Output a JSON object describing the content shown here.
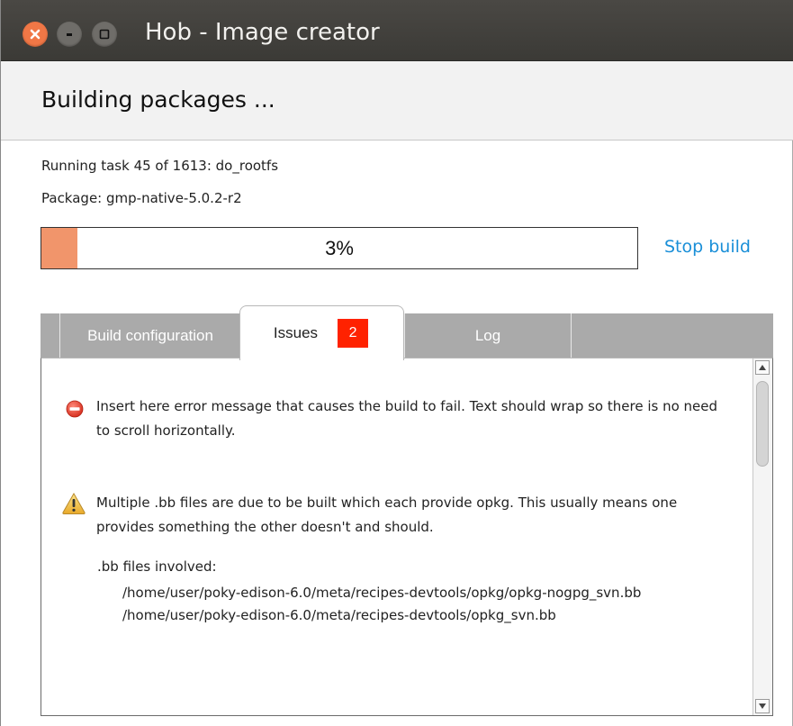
{
  "window": {
    "title": "Hob - Image creator",
    "close_glyph": "✕",
    "minimize_glyph": "-",
    "maximize_glyph": "□"
  },
  "header": {
    "title": "Building packages ..."
  },
  "status": {
    "task_line": "Running task 45 of 1613:  do_rootfs",
    "package_line": "Package: gmp-native-5.0.2-r2"
  },
  "progress": {
    "percent": 3,
    "label": "3%",
    "fill_color": "#f1956b"
  },
  "actions": {
    "stop_build_label": "Stop build",
    "link_color": "#1a8fd8"
  },
  "tabs": [
    {
      "label": "Build configuration",
      "active": false
    },
    {
      "label": "Issues",
      "active": true,
      "badge": "2",
      "badge_color": "#ff2200"
    },
    {
      "label": "Log",
      "active": false
    }
  ],
  "issues": {
    "error": {
      "icon": "error-icon",
      "text": "Insert here error message that causes the build to fail. Text should wrap so there is no need to scroll horizontally."
    },
    "warning": {
      "icon": "warning-icon",
      "text": "Multiple .bb files are due to be built which each provide opkg. This usually means one provides something the other doesn't and should.",
      "files_label": ".bb files involved:",
      "files": [
        "/home/user/poky-edison-6.0/meta/recipes-devtools/opkg/opkg-nogpg_svn.bb",
        "/home/user/poky-edison-6.0/meta/recipes-devtools/opkg_svn.bb"
      ]
    }
  }
}
